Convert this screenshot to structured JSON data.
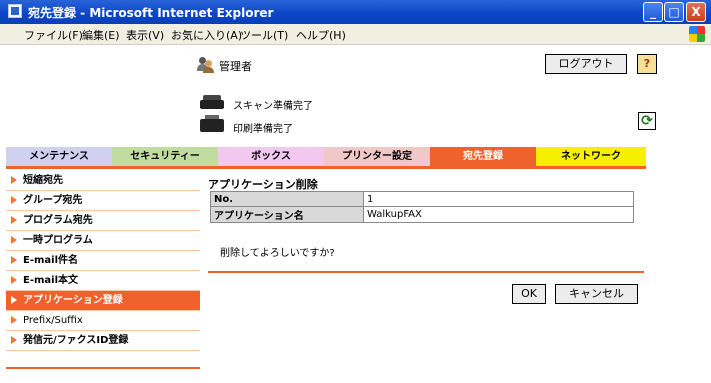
{
  "window": {
    "title": "宛先登録 - Microsoft Internet Explorer",
    "buttons": {
      "minimize": "_",
      "maximize": "□",
      "close": "X"
    }
  },
  "menubar": {
    "items": [
      "ファイル(F)",
      "編集(E)",
      "表示(V)",
      "お気に入り(A)",
      "ツール(T)",
      "ヘルプ(H)"
    ]
  },
  "header": {
    "user_label": "管理者",
    "logout_label": "ログアウト",
    "help_label": "?",
    "scan_status": "スキャン準備完了",
    "print_status": "印刷準備完了",
    "refresh_label": "⟳"
  },
  "tabs": [
    {
      "label": "メンテナンス",
      "color": "#d0d0f0"
    },
    {
      "label": "セキュリティー",
      "color": "#c0dca0"
    },
    {
      "label": "ボックス",
      "color": "#f0c8f0"
    },
    {
      "label": "プリンター設定",
      "color": "#f0c8c8"
    },
    {
      "label": "宛先登録",
      "color": "#f0622c",
      "active": true
    },
    {
      "label": "ネットワーク",
      "color": "#f6f000"
    }
  ],
  "sidebar": {
    "items": [
      "短縮宛先",
      "グループ宛先",
      "プログラム宛先",
      "一時プログラム",
      "E-mail件名",
      "E-mail本文",
      "アプリケーション登録",
      "Prefix/Suffix",
      "発信元/ファクスID登録"
    ],
    "active_index": 6
  },
  "main": {
    "title": "アプリケーション削除",
    "rows": [
      {
        "label": "No.",
        "value": "1"
      },
      {
        "label": "アプリケーション名",
        "value": "WalkupFAX"
      }
    ],
    "confirm_text": "削除してよろしいですか?",
    "ok_label": "OK",
    "cancel_label": "キャンセル"
  }
}
